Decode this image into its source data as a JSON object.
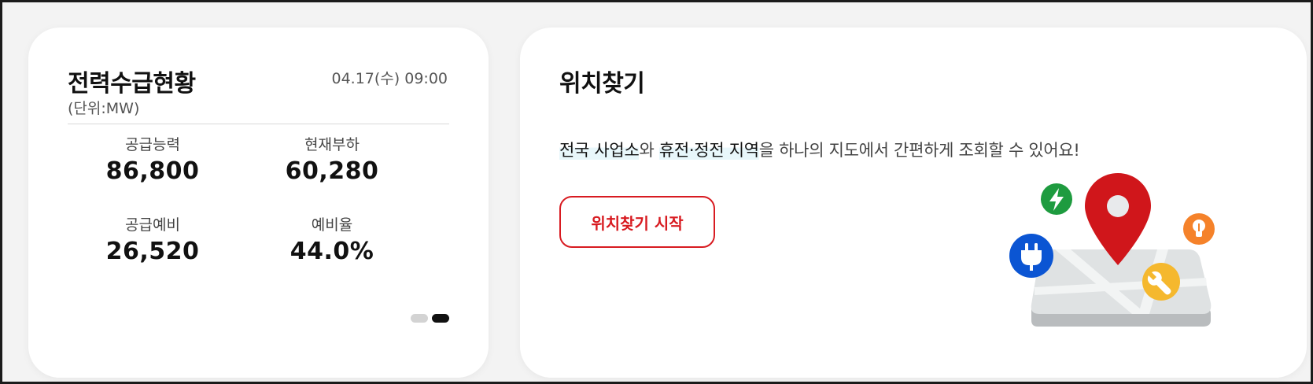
{
  "supply": {
    "title": "전력수급현황",
    "unit": "(단위:MW)",
    "datetime": "04.17(수)  09:00",
    "stats": [
      {
        "label": "공급능력",
        "value": "86,800"
      },
      {
        "label": "현재부하",
        "value": "60,280"
      },
      {
        "label": "공급예비",
        "value": "26,520"
      },
      {
        "label": "예비율",
        "value": "44.0%"
      }
    ],
    "pagination": {
      "total": 2,
      "active": 2
    }
  },
  "location": {
    "title": "위치찾기",
    "desc": {
      "part1": "전국 사업소",
      "part2": "와 ",
      "part3": "휴전·정전 지역",
      "part4": "을 하나의 지도에서 간편하게 조회할 수 있어요!"
    },
    "button_label": "위치찾기 시작"
  },
  "colors": {
    "accent_red": "#d81b21",
    "pin_red": "#d0161b",
    "icon_green": "#1e9b3f",
    "icon_blue": "#0b55d3",
    "icon_orange": "#f5822a",
    "icon_yellow": "#f5b82e"
  },
  "icons": [
    "map-pin-icon",
    "lightning-icon",
    "plug-icon",
    "bulb-icon",
    "wrench-icon",
    "map-icon"
  ]
}
